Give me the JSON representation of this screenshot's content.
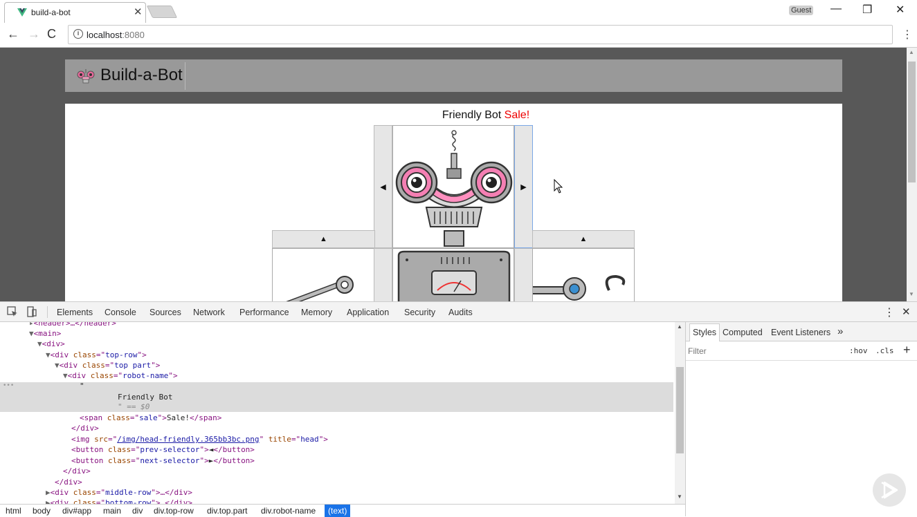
{
  "browser": {
    "tab_title": "build-a-bot",
    "profile": "Guest",
    "url_host": "localhost",
    "url_port": ":8080"
  },
  "page": {
    "brand": "Build-a-Bot",
    "robot_name_text": "Friendly Bot",
    "robot_name_sale": "Sale!",
    "prev_arrow": "◀",
    "next_arrow": "▶",
    "up_arrow": "▲"
  },
  "devtools": {
    "tabs": [
      "Elements",
      "Console",
      "Sources",
      "Network",
      "Performance",
      "Memory",
      "Application",
      "Security",
      "Audits"
    ],
    "styles_tabs": [
      "Styles",
      "Computed",
      "Event Listeners"
    ],
    "more_tabs": "»",
    "filter_placeholder": "Filter",
    "hov": ":hov",
    "cls": ".cls",
    "plus": "+",
    "dom": {
      "header": "<header>…</header>",
      "main": "<main>",
      "div": "<div>",
      "top_row": "top-row",
      "top_part": "top part",
      "robot_name": "robot-name",
      "quote": "\"",
      "text_node": "Friendly Bot",
      "selected_marker": "\" == $0",
      "sale_class": "sale",
      "sale_text": "Sale!",
      "img_src": "/img/head-friendly.365bb3bc.png",
      "img_title": "head",
      "prev_class": "prev-selector",
      "next_class": "next-selector",
      "prev_glyph": "◄",
      "next_glyph": "►",
      "middle_row": "middle-row",
      "bottom_row": "bottom-row"
    },
    "breadcrumbs": [
      "html",
      "body",
      "div#app",
      "main",
      "div",
      "div.top-row",
      "div.top.part",
      "div.robot-name",
      "(text)"
    ]
  },
  "colors": {
    "sale": "#ee0000",
    "header_bg": "#999999",
    "page_bg": "#585858",
    "selection": "#1a73e8",
    "tag": "#881280",
    "attr": "#994500",
    "value": "#1a1aa6"
  }
}
